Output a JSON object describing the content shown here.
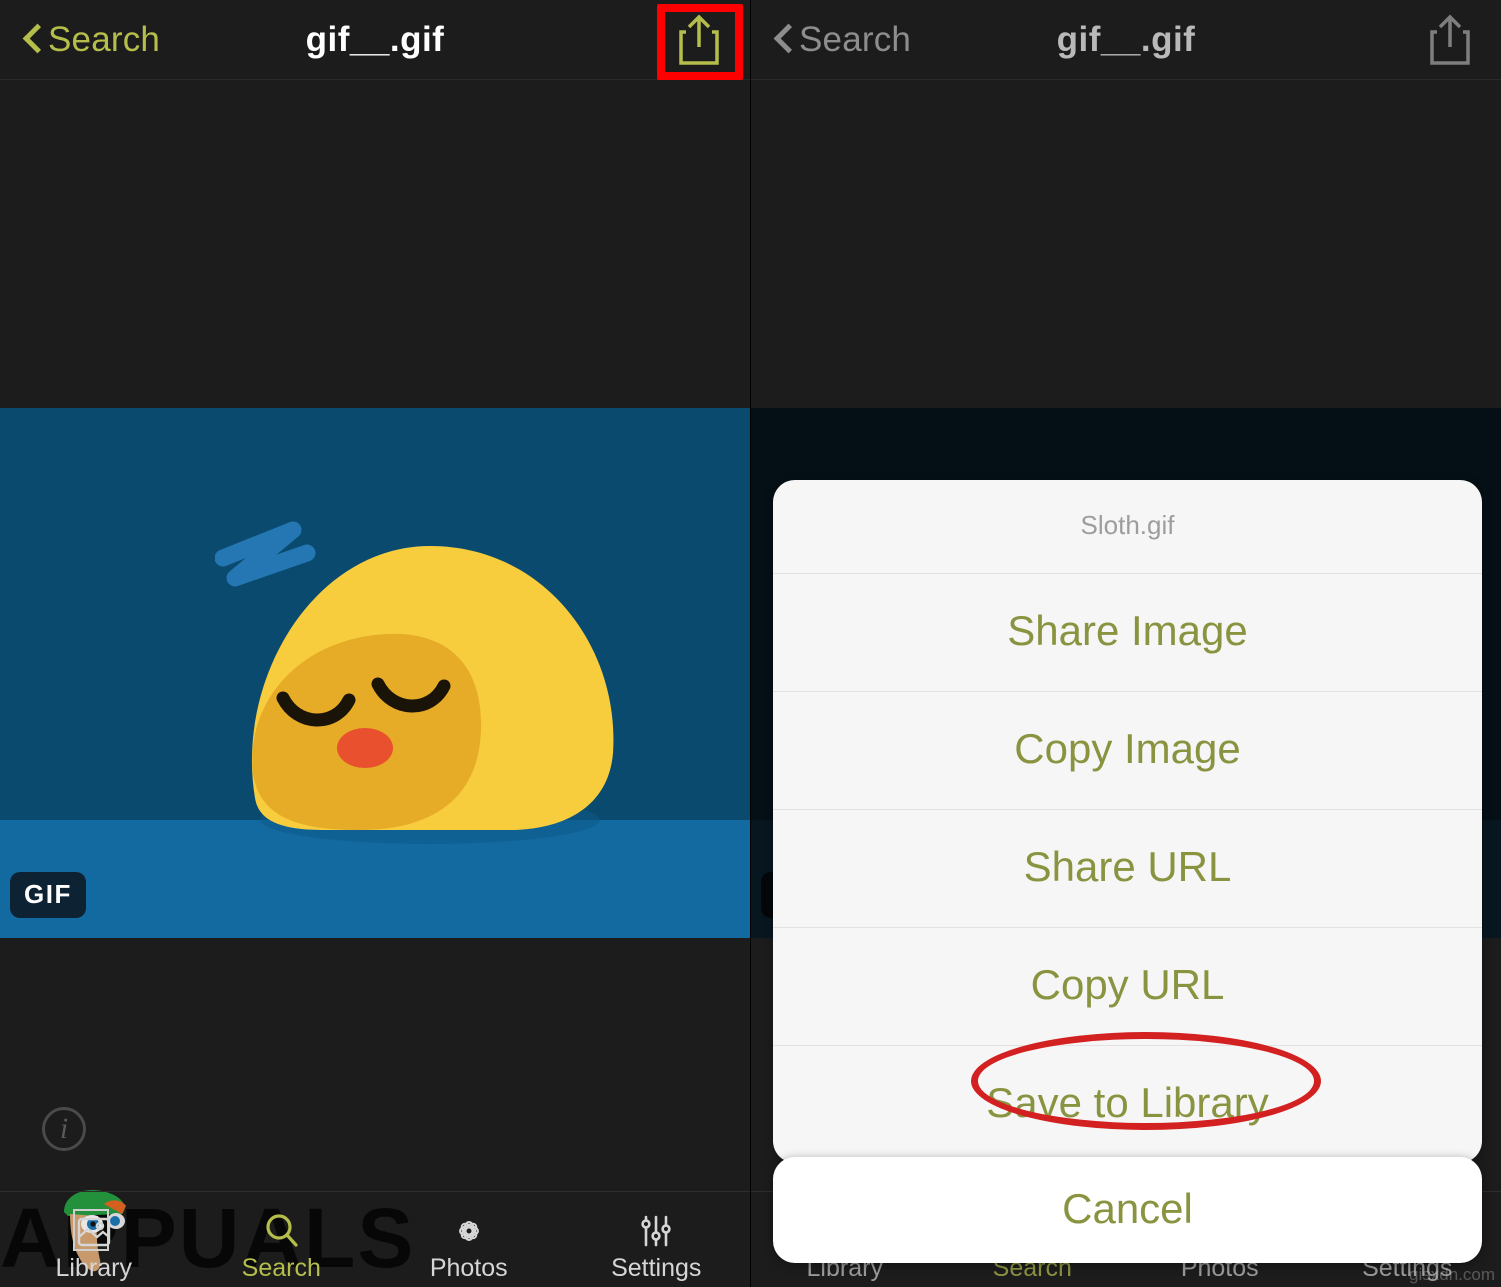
{
  "panels": {
    "left": {
      "navbar": {
        "back_label": "Search",
        "title": "gif__.gif",
        "share_icon": "share-icon"
      },
      "media": {
        "badge": "GIF",
        "alt": "sleeping yellow blob character on blue background with Zzz"
      },
      "info_icon": "info-icon",
      "watermark": "APPUALS"
    },
    "right": {
      "navbar": {
        "back_label": "Search",
        "title": "gif__.gif",
        "share_icon": "share-icon"
      },
      "sheet": {
        "title": "Sloth.gif",
        "items": [
          {
            "label": "Share Image"
          },
          {
            "label": "Copy Image"
          },
          {
            "label": "Share URL"
          },
          {
            "label": "Copy URL"
          },
          {
            "label": "Save to Library"
          }
        ],
        "cancel_label": "Cancel"
      },
      "watermark": "gisxdn.com"
    }
  },
  "tabbar": {
    "items": [
      {
        "label": "Library",
        "icon": "library-icon",
        "active": false
      },
      {
        "label": "Search",
        "icon": "search-icon",
        "active": true
      },
      {
        "label": "Photos",
        "icon": "photos-icon",
        "active": false
      },
      {
        "label": "Settings",
        "icon": "settings-icon",
        "active": false
      }
    ]
  },
  "annotations": {
    "share_highlight_color": "#fe0000",
    "save_to_library_circle_color": "#d32020"
  },
  "colors": {
    "accent_green": "#b5bd4b",
    "sheet_text": "#8a9440",
    "background": "#1c1c1c",
    "gif_blue": "#0a4a6e",
    "gif_floor_blue": "#136aa0",
    "blob_yellow": "#f5c842"
  }
}
